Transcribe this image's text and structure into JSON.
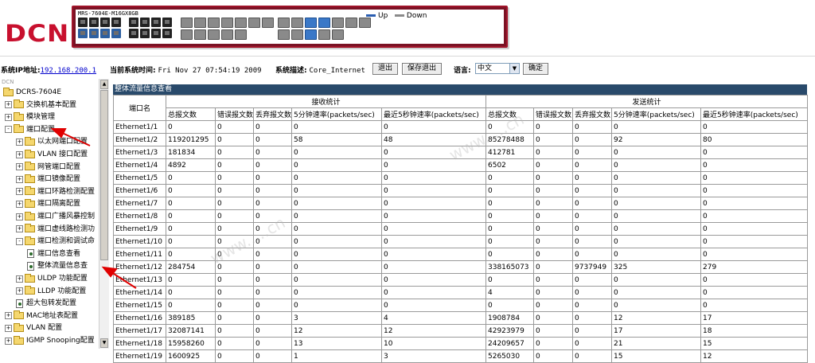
{
  "banner": {
    "logo": "DCN",
    "model": "MRS-7604E-M16GX8GB",
    "legend": {
      "up_label": "Up",
      "down_label": "Down",
      "up_color": "#2a5db0",
      "down_color": "#8a8a8a"
    }
  },
  "infobar": {
    "ip_label": "系统IP地址:",
    "ip_value": "192.168.200.1",
    "time_label": "当前系统时间:",
    "time_value": "Fri Nov 27 07:54:19 2009",
    "desc_label": "系统描述:",
    "desc_value": "Core_Internet",
    "logout_label": "退出",
    "save_logout_label": "保存退出",
    "lang_label": "语言:",
    "lang_value": "中文",
    "confirm_label": "确定"
  },
  "tree": {
    "root_caption": "DCN",
    "items": [
      {
        "label": "DCRS-7604E",
        "kind": "root"
      },
      {
        "label": "交换机基本配置",
        "kind": "folder",
        "sign": "+"
      },
      {
        "label": "模块管理",
        "kind": "folder",
        "sign": "+"
      },
      {
        "label": "端口配置",
        "kind": "folder",
        "sign": "-"
      },
      {
        "label": "以太网端口配置",
        "kind": "folder",
        "sign": "+"
      },
      {
        "label": "VLAN 接口配置",
        "kind": "folder",
        "sign": "+"
      },
      {
        "label": "网管端口配置",
        "kind": "folder",
        "sign": "+"
      },
      {
        "label": "端口镜像配置",
        "kind": "folder",
        "sign": "+"
      },
      {
        "label": "端口环路检测配置",
        "kind": "folder",
        "sign": "+"
      },
      {
        "label": "端口隔离配置",
        "kind": "folder",
        "sign": "+"
      },
      {
        "label": "端口广播风暴控制",
        "kind": "folder",
        "sign": "+"
      },
      {
        "label": "端口虚线路检测功",
        "kind": "folder",
        "sign": "+"
      },
      {
        "label": "端口检测和调试命",
        "kind": "folder",
        "sign": "-"
      },
      {
        "label": "端口信息查看",
        "kind": "page"
      },
      {
        "label": "整体流量信息查",
        "kind": "page"
      },
      {
        "label": "ULDP 功能配置",
        "kind": "folder",
        "sign": "+"
      },
      {
        "label": "LLDP 功能配置",
        "kind": "folder",
        "sign": "+"
      },
      {
        "label": "超大包转发配置",
        "kind": "page"
      },
      {
        "label": "MAC地址表配置",
        "kind": "folder",
        "sign": "+"
      },
      {
        "label": "VLAN 配置",
        "kind": "folder",
        "sign": "+"
      },
      {
        "label": "IGMP Snooping配置",
        "kind": "folder",
        "sign": "+"
      }
    ]
  },
  "panel": {
    "title": "整体流量信息查看",
    "port_header": "端口名",
    "rx_header": "接收统计",
    "tx_header": "发送统计",
    "columns": [
      "总报文数",
      "错误报文数",
      "丢弃报文数",
      "5分钟速率(packets/sec)",
      "最近5秒钟速率(packets/sec)"
    ],
    "rows": [
      [
        "Ethernet1/1",
        "0",
        "0",
        "0",
        "0",
        "0",
        "0",
        "0",
        "0",
        "0",
        "0"
      ],
      [
        "Ethernet1/2",
        "119201295",
        "0",
        "0",
        "58",
        "48",
        "85278488",
        "0",
        "0",
        "92",
        "80"
      ],
      [
        "Ethernet1/3",
        "181834",
        "0",
        "0",
        "0",
        "0",
        "412781",
        "0",
        "0",
        "0",
        "0"
      ],
      [
        "Ethernet1/4",
        "4892",
        "0",
        "0",
        "0",
        "0",
        "6502",
        "0",
        "0",
        "0",
        "0"
      ],
      [
        "Ethernet1/5",
        "0",
        "0",
        "0",
        "0",
        "0",
        "0",
        "0",
        "0",
        "0",
        "0"
      ],
      [
        "Ethernet1/6",
        "0",
        "0",
        "0",
        "0",
        "0",
        "0",
        "0",
        "0",
        "0",
        "0"
      ],
      [
        "Ethernet1/7",
        "0",
        "0",
        "0",
        "0",
        "0",
        "0",
        "0",
        "0",
        "0",
        "0"
      ],
      [
        "Ethernet1/8",
        "0",
        "0",
        "0",
        "0",
        "0",
        "0",
        "0",
        "0",
        "0",
        "0"
      ],
      [
        "Ethernet1/9",
        "0",
        "0",
        "0",
        "0",
        "0",
        "0",
        "0",
        "0",
        "0",
        "0"
      ],
      [
        "Ethernet1/10",
        "0",
        "0",
        "0",
        "0",
        "0",
        "0",
        "0",
        "0",
        "0",
        "0"
      ],
      [
        "Ethernet1/11",
        "0",
        "0",
        "0",
        "0",
        "0",
        "0",
        "0",
        "0",
        "0",
        "0"
      ],
      [
        "Ethernet1/12",
        "284754",
        "0",
        "0",
        "0",
        "0",
        "338165073",
        "0",
        "9737949",
        "325",
        "279"
      ],
      [
        "Ethernet1/13",
        "0",
        "0",
        "0",
        "0",
        "0",
        "0",
        "0",
        "0",
        "0",
        "0"
      ],
      [
        "Ethernet1/14",
        "0",
        "0",
        "0",
        "0",
        "0",
        "4",
        "0",
        "0",
        "0",
        "0"
      ],
      [
        "Ethernet1/15",
        "0",
        "0",
        "0",
        "0",
        "0",
        "0",
        "0",
        "0",
        "0",
        "0"
      ],
      [
        "Ethernet1/16",
        "389185",
        "0",
        "0",
        "3",
        "4",
        "1908784",
        "0",
        "0",
        "12",
        "17"
      ],
      [
        "Ethernet1/17",
        "32087141",
        "0",
        "0",
        "12",
        "12",
        "42923979",
        "0",
        "0",
        "17",
        "18"
      ],
      [
        "Ethernet1/18",
        "15958260",
        "0",
        "0",
        "13",
        "10",
        "24209657",
        "0",
        "0",
        "21",
        "15"
      ],
      [
        "Ethernet1/19",
        "1600925",
        "0",
        "0",
        "1",
        "3",
        "5265030",
        "0",
        "0",
        "15",
        "12"
      ]
    ]
  },
  "annotation_color": "#e00000"
}
